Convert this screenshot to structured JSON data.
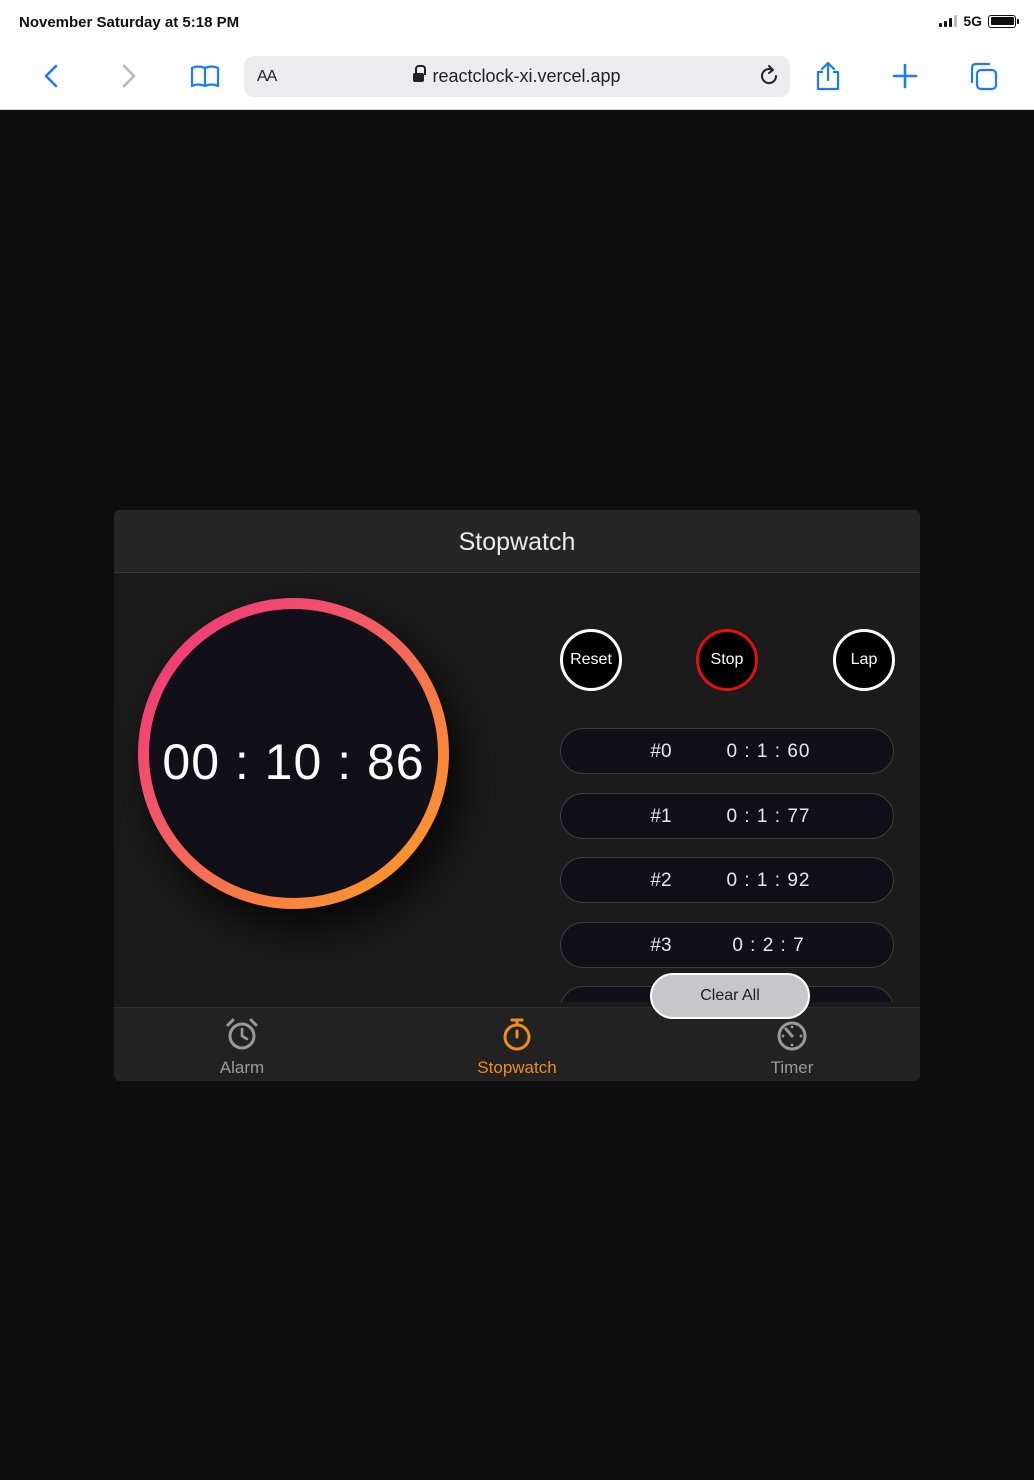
{
  "status_bar": {
    "datetime": "November Saturday at 5:18 PM",
    "network": "5G"
  },
  "browser": {
    "text_size_label": "AA",
    "url": "reactclock-xi.vercel.app",
    "icons": [
      "back-icon",
      "forward-icon",
      "bookmarks-icon",
      "lock-icon",
      "reload-icon",
      "share-icon",
      "new-tab-icon",
      "tabs-icon"
    ]
  },
  "app": {
    "title": "Stopwatch",
    "elapsed": "00 : 10 : 86",
    "controls": {
      "reset_label": "Reset",
      "stop_label": "Stop",
      "lap_label": "Lap"
    },
    "laps": [
      {
        "num": "#0",
        "time": "0 : 1 : 60"
      },
      {
        "num": "#1",
        "time": "0 : 1 : 77"
      },
      {
        "num": "#2",
        "time": "0 : 1 : 92"
      },
      {
        "num": "#3",
        "time": "0 : 2 : 7"
      },
      {
        "num": "",
        "time": ""
      }
    ],
    "clear_all_label": "Clear All",
    "tabs": [
      {
        "label": "Alarm",
        "icon": "alarm-clock-icon",
        "active": false
      },
      {
        "label": "Stopwatch",
        "icon": "stopwatch-icon",
        "active": true
      },
      {
        "label": "Timer",
        "icon": "timer-icon",
        "active": false
      }
    ]
  },
  "colors": {
    "accent": "#f08c1c",
    "stop_ring": "#e01010",
    "ring_gradient_start": "#ef2f7f",
    "ring_gradient_end": "#fba022",
    "page_background": "#0e0e0e",
    "browser_blue": "#1a7cf5"
  }
}
